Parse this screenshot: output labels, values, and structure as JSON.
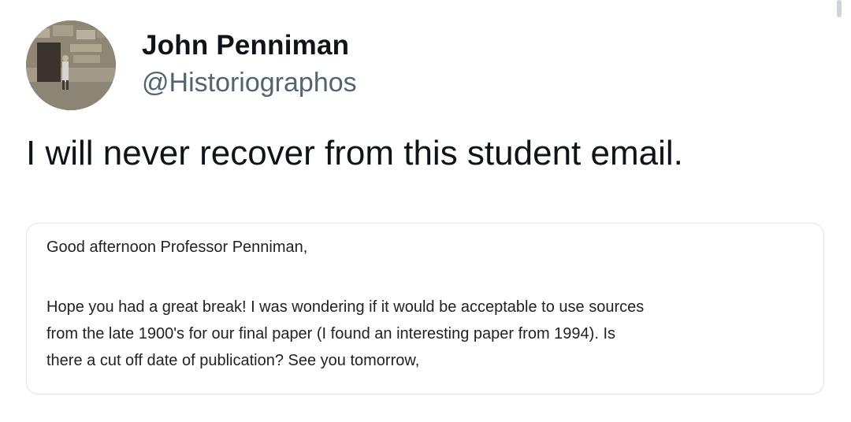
{
  "author": {
    "display_name": "John Penniman",
    "handle": "@Historiographos"
  },
  "tweet": {
    "text": "I will never recover from this student email."
  },
  "email": {
    "greeting": "Good afternoon Professor Penniman,",
    "body_lines": [
      "Hope you had a great break! I was wondering if it would be acceptable to use sources",
      "from the late 1900's for our final paper (I found an interesting paper from 1994). Is",
      "there a cut off date of publication? See you tomorrow,"
    ]
  },
  "colors": {
    "text_primary": "#0f1419",
    "text_secondary": "#536471",
    "card_border": "#e3e6ea"
  }
}
